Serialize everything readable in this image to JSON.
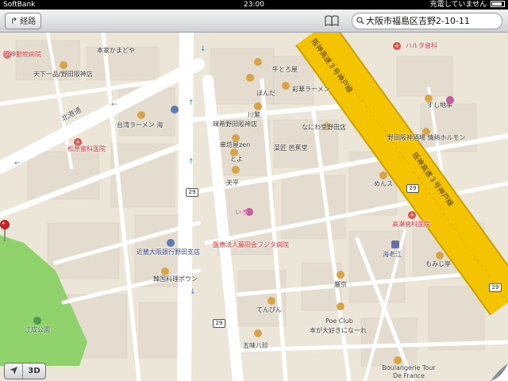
{
  "status_bar": {
    "carrier": "SoftBank",
    "time": "23:00",
    "battery_text": "充電していません"
  },
  "toolbar": {
    "directions_label": "経路",
    "search_value": "大阪市福島区吉野2-10-11"
  },
  "map": {
    "road_labels": [
      {
        "text": "北港通"
      }
    ],
    "expressway_labels": [
      {
        "text": "阪神高速３号神戸線"
      },
      {
        "text": "阪神高速３号神戸線"
      }
    ],
    "route_shields": [
      {
        "text": "29"
      },
      {
        "text": "29"
      },
      {
        "text": "29"
      },
      {
        "text": "29"
      }
    ],
    "places": [
      {
        "text": "阪神動物病院",
        "style": "red",
        "icon": "medical"
      },
      {
        "text": "本家かまどや",
        "style": "normal",
        "icon": "none"
      },
      {
        "text": "天下一品/野田阪神店",
        "style": "normal",
        "icon": "food"
      },
      {
        "text": "ハルタ歯科",
        "style": "red",
        "icon": "medical"
      },
      {
        "text": "牛とろ屋",
        "style": "normal",
        "icon": "food"
      },
      {
        "text": "ほんだ",
        "style": "normal",
        "icon": "food"
      },
      {
        "text": "彩華ラーメン",
        "style": "normal",
        "icon": "food"
      },
      {
        "text": "すし地率",
        "style": "normal",
        "icon": "food"
      },
      {
        "text": "台湾ラーメン 海",
        "style": "normal",
        "icon": "food"
      },
      {
        "text": "川繁",
        "style": "normal",
        "icon": "food"
      },
      {
        "text": "味希野田阪神店",
        "style": "normal",
        "icon": "food"
      },
      {
        "text": "なにわ堂野田店",
        "style": "normal",
        "icon": "food"
      },
      {
        "text": "野田阪神酒場 情熱ホルモン",
        "style": "normal",
        "icon": "food"
      },
      {
        "text": "松原歯科医院",
        "style": "red",
        "icon": "medical"
      },
      {
        "text": "串坊屋zen",
        "style": "normal",
        "icon": "food"
      },
      {
        "text": "とよ",
        "style": "normal",
        "icon": "food"
      },
      {
        "text": "菜匠 芭蕉堂",
        "style": "normal",
        "icon": "food"
      },
      {
        "text": "天平",
        "style": "normal",
        "icon": "food"
      },
      {
        "text": "めんス",
        "style": "normal",
        "icon": "food"
      },
      {
        "text": "いろ",
        "style": "pink",
        "icon": "shop"
      },
      {
        "text": "高瀬歯科医院",
        "style": "red",
        "icon": "medical"
      },
      {
        "text": "医療法人藤田会フジタ病院",
        "style": "red",
        "icon": "medical"
      },
      {
        "text": "近畿大阪銀行野田支店",
        "style": "blue",
        "icon": "bank"
      },
      {
        "text": "海老江",
        "style": "blue",
        "icon": "station"
      },
      {
        "text": "もみじ亭",
        "style": "normal",
        "icon": "food"
      },
      {
        "text": "韓国料理ポウン",
        "style": "normal",
        "icon": "food"
      },
      {
        "text": "厳京",
        "style": "normal",
        "icon": "food"
      },
      {
        "text": "てんぴん",
        "style": "normal",
        "icon": "food"
      },
      {
        "text": "Poe Club",
        "style": "normal",
        "icon": "food"
      },
      {
        "text": "本が大好きになーれ",
        "style": "normal",
        "icon": "none"
      },
      {
        "text": "江成公園",
        "style": "green",
        "icon": "park"
      },
      {
        "text": "五味八珍",
        "style": "normal",
        "icon": "food"
      },
      {
        "text": "Boulangerie Tour De France",
        "style": "normal",
        "icon": "food"
      }
    ]
  },
  "controls": {
    "threed_label": "3D"
  },
  "colors": {
    "expressway": "#f5c400",
    "park": "#8fd16a",
    "land": "#ece6d9",
    "road": "#ffffff",
    "pin": "#d21f26"
  }
}
